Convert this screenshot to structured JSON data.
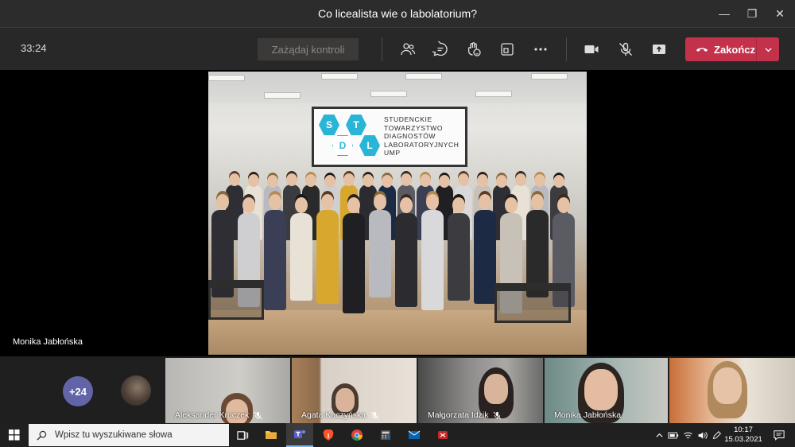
{
  "window": {
    "title": "Co licealista wie o labolatorium?",
    "minimize_glyph": "—",
    "restore_glyph": "❐",
    "close_glyph": "✕"
  },
  "toolbar": {
    "timer": "33:24",
    "request_control_label": "Zażądaj kontroli",
    "end_label": "Zakończ",
    "icons": [
      "people-icon",
      "chat-icon",
      "reactions-icon",
      "rooms-icon",
      "more-icon",
      "camera-icon",
      "mic-muted-icon",
      "share-icon"
    ],
    "accent": "#c4314b"
  },
  "stage": {
    "presenter_name": "Monika Jabłońska",
    "screen": {
      "letters": [
        "S",
        "T",
        "D",
        "L"
      ],
      "lines": [
        "STUDENCKIE",
        "TOWARZYSTWO",
        "DIAGNOSTÓW",
        "LABORATORYJNYCH",
        "UMP"
      ]
    }
  },
  "participants": {
    "more_count": "+24",
    "tiles": [
      {
        "name": "Aleksander Kruczek",
        "muted": true
      },
      {
        "name": "Agata Kaczyńska",
        "muted": true
      },
      {
        "name": "Małgorzata Idzik",
        "muted": true
      },
      {
        "name": "Monika Jabłońska",
        "muted": false
      },
      {
        "name": "",
        "muted": false
      }
    ]
  },
  "taskbar": {
    "search_placeholder": "Wpisz tu wyszukiwane słowa",
    "time": "10:17",
    "date": "15.03.2021",
    "apps": [
      "task-view-icon",
      "file-explorer-icon",
      "teams-icon",
      "brave-icon",
      "chrome-icon",
      "calculator-icon",
      "mail-icon",
      "app-icon"
    ]
  }
}
